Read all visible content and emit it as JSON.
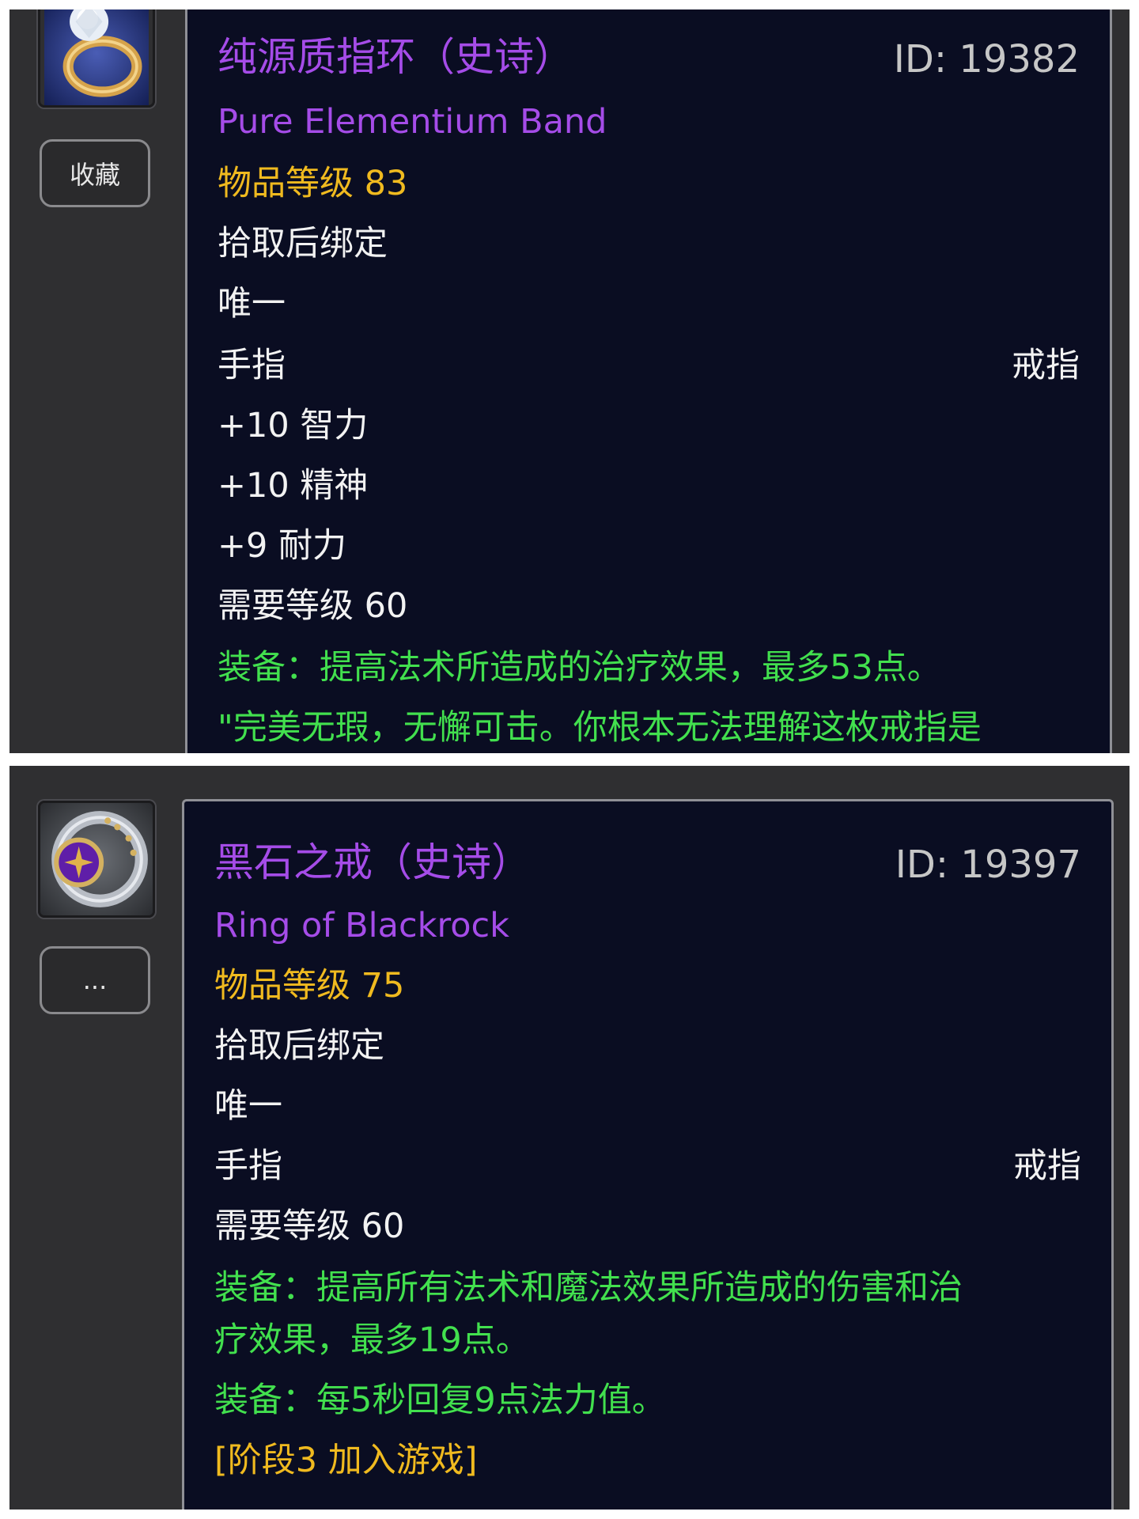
{
  "items": [
    {
      "name_cn": "纯源质指环（史诗）",
      "name_en": "Pure Elementium Band",
      "id_label": "ID: 19382",
      "item_level": "物品等级 83",
      "binding": "拾取后绑定",
      "unique": "唯一",
      "slot": "手指",
      "type": "戒指",
      "stats": [
        "+10 智力",
        "+10 精神",
        "+9 耐力"
      ],
      "required_level": "需要等级 60",
      "equip_effects": [
        "装备：提高法术所造成的治疗效果，最多53点。"
      ],
      "flavor_text": "\"完美无瑕，无懈可击。你根本无法理解这枚戒指是",
      "side_button_label": "收藏",
      "icon": "diamond-ring-icon"
    },
    {
      "name_cn": "黑石之戒（史诗）",
      "name_en": "Ring of Blackrock",
      "id_label": "ID: 19397",
      "item_level": "物品等级 75",
      "binding": "拾取后绑定",
      "unique": "唯一",
      "slot": "手指",
      "type": "戒指",
      "required_level": "需要等级 60",
      "equip_effects": [
        "装备：提高所有法术和魔法效果所造成的伤害和治",
        "疗效果，最多19点。",
        "装备：每5秒回复9点法力值。"
      ],
      "phase": "[阶段3 加入游戏]",
      "side_button_label": "...",
      "icon": "blackrock-ring-icon"
    }
  ],
  "colors": {
    "epic_purple": "#a54ce8",
    "item_level_gold": "#f0ba1f",
    "equip_green": "#42e04e",
    "tooltip_bg": "#0a0d22",
    "panel_bg": "#2f2f31"
  }
}
